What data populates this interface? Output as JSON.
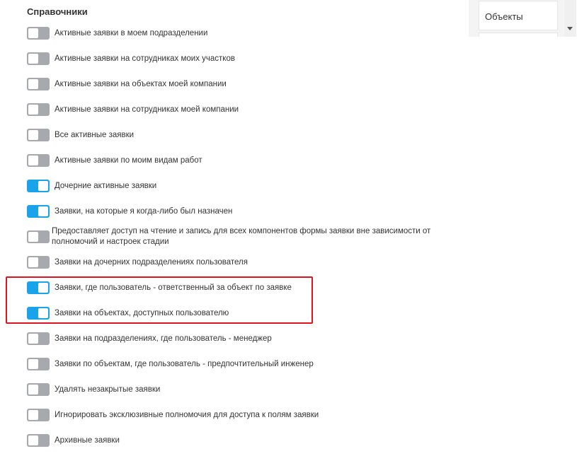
{
  "section": {
    "title": "Справочники"
  },
  "side": {
    "tab_label": "Объекты"
  },
  "permissions": [
    {
      "label": "Активные заявки в моем подразделении",
      "enabled": false
    },
    {
      "label": "Активные заявки на сотрудниках моих участков",
      "enabled": false
    },
    {
      "label": "Активные заявки на объектах моей компании",
      "enabled": false
    },
    {
      "label": "Активные заявки на сотрудниках моей компании",
      "enabled": false
    },
    {
      "label": "Все активные заявки",
      "enabled": false
    },
    {
      "label": "Активные заявки по моим видам работ",
      "enabled": false
    },
    {
      "label": "Дочерние активные заявки",
      "enabled": true
    },
    {
      "label": "Заявки, на которые я когда-либо был назначен",
      "enabled": true
    },
    {
      "label": "Предоставляет доступ на чтение и запись для всех компонентов формы заявки вне зависимости от полномочий и настроек стадии",
      "enabled": false
    },
    {
      "label": "Заявки на дочерних подразделениях пользователя",
      "enabled": false
    },
    {
      "label": "Заявки, где пользователь - ответственный за объект по заявке",
      "enabled": true
    },
    {
      "label": "Заявки на объектах, доступных пользователю",
      "enabled": true
    },
    {
      "label": "Заявки на подразделениях, где пользователь - менеджер",
      "enabled": false
    },
    {
      "label": "Заявки по объектам, где пользователь - предпочтительный инженер",
      "enabled": false
    },
    {
      "label": "Удалять незакрытые заявки",
      "enabled": false
    },
    {
      "label": "Игнорировать эксклюзивные полномочия для доступа к полям заявки",
      "enabled": false
    },
    {
      "label": "Архивные заявки",
      "enabled": false
    }
  ],
  "colors": {
    "toggle_on": "#1aa3e8",
    "toggle_off": "#a6a9ad",
    "highlight": "#e0141e"
  }
}
